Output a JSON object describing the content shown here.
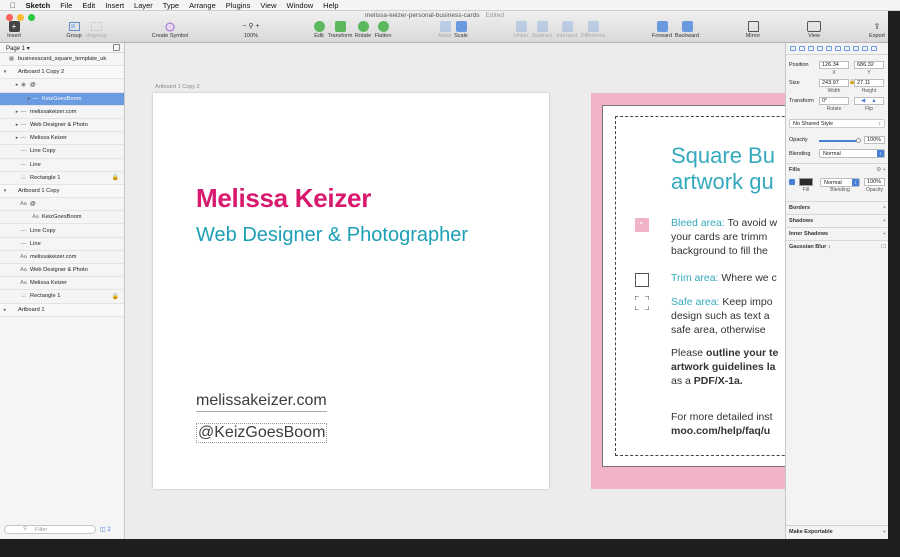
{
  "menubar": {
    "app": "Sketch",
    "items": [
      "File",
      "Edit",
      "Insert",
      "Layer",
      "Type",
      "Arrange",
      "Plugins",
      "View",
      "Window",
      "Help"
    ]
  },
  "window": {
    "title": "melissa-keizer-personal-business-cards",
    "status": "Edited"
  },
  "toolbar": {
    "insert": "Insert",
    "group": "Group",
    "ungroup": "Ungroup",
    "create_symbol": "Create Symbol",
    "zoom": "100%",
    "edit": "Edit",
    "transform": "Transform",
    "rotate": "Rotate",
    "flatten": "Flatten",
    "mask": "Mask",
    "scale": "Scale",
    "union": "Union",
    "subtract": "Subtract",
    "intersect": "Intersect",
    "difference": "Difference",
    "forward": "Forward",
    "backward": "Backward",
    "mirror": "Mirror",
    "view": "View",
    "export": "Export"
  },
  "layers": {
    "page": "Page 1",
    "rows": [
      {
        "label": "businesscard_square_template_uk",
        "indent": 0,
        "kind": "image"
      },
      {
        "label": "Artboard 1 Copy 2",
        "indent": 0,
        "kind": "artboard"
      },
      {
        "label": "@",
        "indent": 1,
        "kind": "group"
      },
      {
        "label": "KeizGoesBoom",
        "indent": 2,
        "kind": "line"
      },
      {
        "label": "melissakeizer.com",
        "indent": 1,
        "kind": "line"
      },
      {
        "label": "Web Designer & Photo",
        "indent": 1,
        "kind": "line"
      },
      {
        "label": "Melissa Keizer",
        "indent": 1,
        "kind": "line"
      },
      {
        "label": "Line Copy",
        "indent": 1,
        "kind": "line"
      },
      {
        "label": "Line",
        "indent": 1,
        "kind": "line"
      },
      {
        "label": "Rectangle 1",
        "indent": 1,
        "kind": "rect"
      },
      {
        "label": "Artboard 1 Copy",
        "indent": 0,
        "kind": "artboard"
      },
      {
        "label": "@",
        "indent": 1,
        "kind": "text"
      },
      {
        "label": "KeizGoesBoom",
        "indent": 2,
        "kind": "text"
      },
      {
        "label": "Line Copy",
        "indent": 1,
        "kind": "line"
      },
      {
        "label": "Line",
        "indent": 1,
        "kind": "line"
      },
      {
        "label": "melissakeizer.com",
        "indent": 1,
        "kind": "text"
      },
      {
        "label": "Web Designer & Photo",
        "indent": 1,
        "kind": "text"
      },
      {
        "label": "Melissa Keizer",
        "indent": 1,
        "kind": "text"
      },
      {
        "label": "Rectangle 1",
        "indent": 1,
        "kind": "rect"
      },
      {
        "label": "Artboard 1",
        "indent": 0,
        "kind": "artboard"
      }
    ],
    "filter_placeholder": "Filter",
    "filter_count": "2"
  },
  "canvas": {
    "artboard_title": "Artboard 1 Copy 2",
    "name": "Melissa Keizer",
    "job": "Web Designer & Photographer",
    "url": "melissakeizer.com",
    "handle": "@KeizGoesBoom",
    "guide": {
      "heading1": "Square Bu",
      "heading2": "artwork gu",
      "bleed_label": "Bleed area:",
      "bleed_text": "To avoid w",
      "bleed_line2": "your cards are trimm",
      "bleed_line3": "background to fill the",
      "trim_label": "Trim area:",
      "trim_text": "Where we c",
      "safe_label": "Safe area:",
      "safe_text": "Keep impo",
      "safe_line2": "design such as text a",
      "safe_line3": "safe area, otherwise",
      "please1": "Please",
      "please1b": "outline your te",
      "please2": "artwork guidelines la",
      "please3": "as a",
      "please3b": "PDF/X-1a.",
      "more1": "For more detailed inst",
      "more2": "moo.com/help/faq/u"
    }
  },
  "inspector": {
    "position": "Position",
    "x": "126.34",
    "y": "686.32",
    "x_label": "X",
    "y_label": "Y",
    "size": "Size",
    "width": "243.97",
    "height": "27.11",
    "width_label": "Width",
    "height_label": "Height",
    "transform": "Transform",
    "rotate": "0°",
    "rotate_label": "Rotate",
    "flip_label": "Flip",
    "shared_style": "No Shared Style",
    "opacity": "Opacity",
    "opacity_val": "100%",
    "blending": "Blending",
    "blending_val": "Normal",
    "fills": "Fills",
    "fill_blend": "Normal",
    "fill_opacity": "100%",
    "fill_label": "Fill",
    "fill_blend_label": "Blending",
    "fill_opacity_label": "Opacity",
    "borders": "Borders",
    "shadows": "Shadows",
    "inner_shadows": "Inner Shadows",
    "gaussian_blur": "Gaussian Blur",
    "make_exportable": "Make Exportable"
  },
  "colors": {
    "accent": "#4a7fd6",
    "name": "#d8196d",
    "job": "#1d9fb5",
    "guide_pink": "#f0b3c9"
  }
}
